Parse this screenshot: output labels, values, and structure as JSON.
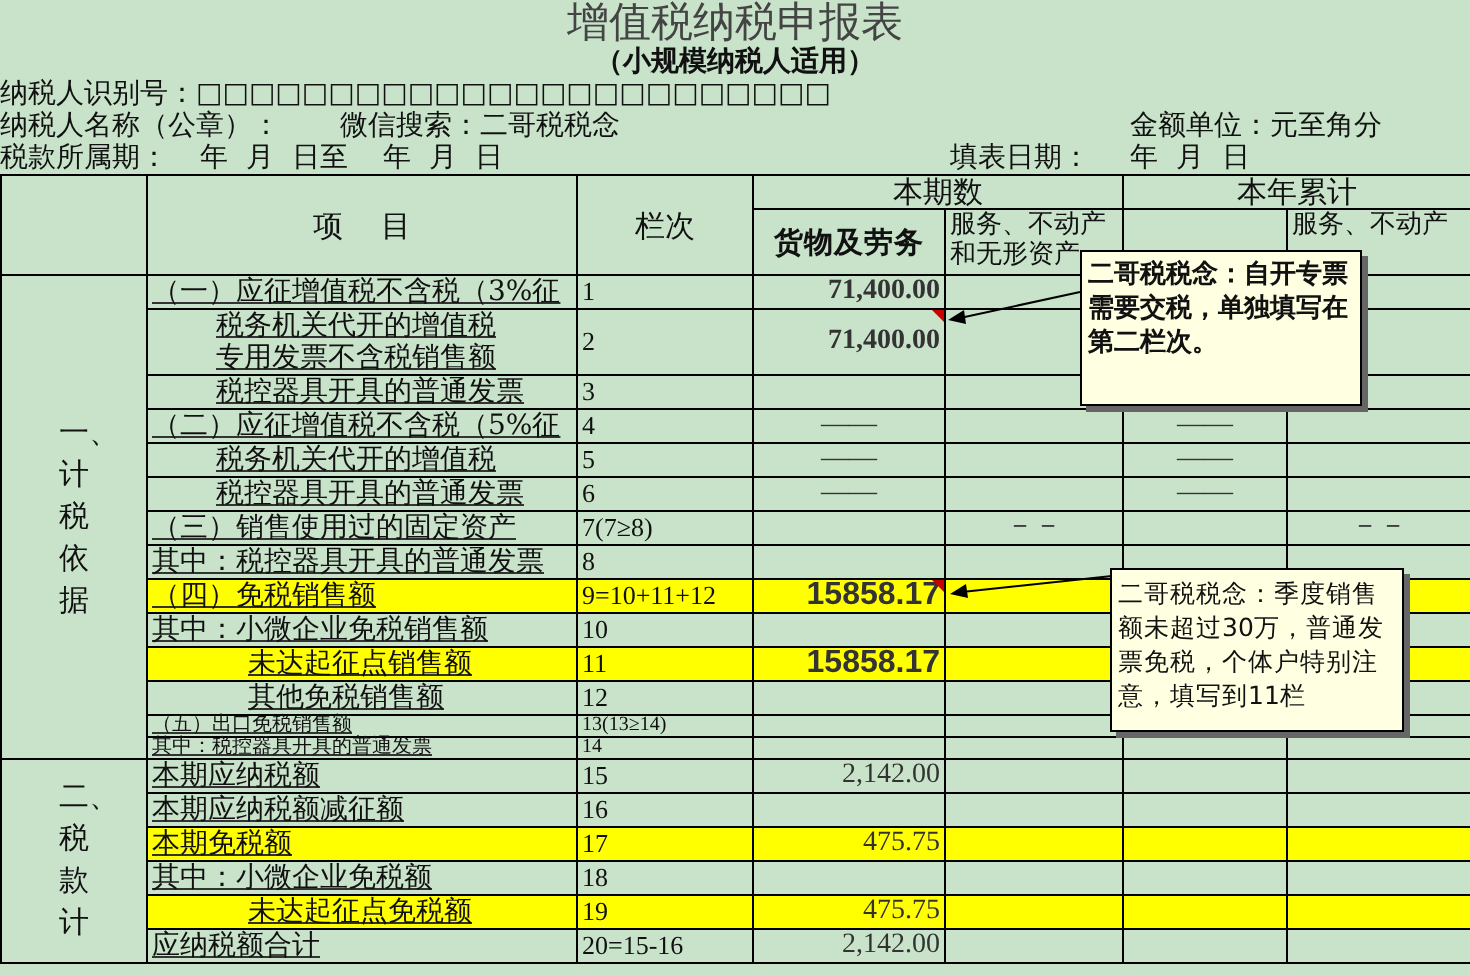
{
  "title": "增值税纳税申报表",
  "subtitle": "（小规模纳税人适用）",
  "taxpayer_id": {
    "label": "纳税人识别号：",
    "value": "□□□□□□□□□□□□□□□□□□□□□□□□"
  },
  "taxpayer_name": {
    "label": "纳税人名称（公章）：",
    "value": "微信搜索：二哥税税念"
  },
  "amount_unit": "金额单位：元至角分",
  "tax_period": {
    "label": "税款所属期：",
    "value": "年  月  日至    年  月  日"
  },
  "fill_date": {
    "label": "填表日期：",
    "value": "年  月  日"
  },
  "columns": {
    "item": "项    目",
    "seq": "栏次",
    "current_period": "本期数",
    "year_to_date": "本年累计",
    "sub": {
      "current_goods": "货物及劳务",
      "current_services": "服务、不动产和无形资产",
      "ytd_services": "服务、不动产"
    }
  },
  "sections": [
    {
      "label": "一、计税依据",
      "rows": [
        {
          "item": "（一）应征增值税不含税（3%征",
          "kind": "main",
          "seq": "1",
          "highlighted": false,
          "has_comment": false,
          "cells": {
            "current_goods": {
              "text": "71,400.00",
              "kind": "bold"
            }
          }
        },
        {
          "item": "税务机关代开的增值税专用发票不含税销售额",
          "kind": "sub",
          "seq": "2",
          "highlighted": false,
          "has_comment": true,
          "cells": {
            "current_goods": {
              "text": "71,400.00",
              "kind": "bold"
            }
          }
        },
        {
          "item": "税控器具开具的普通发票",
          "kind": "sub",
          "seq": "3",
          "highlighted": false,
          "has_comment": false,
          "cells": {}
        },
        {
          "item": "（二）应征增值税不含税（5%征",
          "kind": "main",
          "seq": "4",
          "highlighted": false,
          "has_comment": false,
          "cells": {
            "current_goods": {
              "text": "——",
              "kind": "center"
            },
            "ytd_goods": {
              "text": "——",
              "kind": "center"
            }
          }
        },
        {
          "item": "税务机关代开的增值税",
          "kind": "sub",
          "seq": "5",
          "highlighted": false,
          "has_comment": false,
          "cells": {
            "current_goods": {
              "text": "——",
              "kind": "center"
            },
            "ytd_goods": {
              "text": "——",
              "kind": "center"
            }
          }
        },
        {
          "item": "税控器具开具的普通发票",
          "kind": "sub",
          "seq": "6",
          "highlighted": false,
          "has_comment": false,
          "cells": {
            "current_goods": {
              "text": "——",
              "kind": "center"
            },
            "ytd_goods": {
              "text": "——",
              "kind": "center"
            }
          }
        },
        {
          "item": "（三）销售使用过的固定资产",
          "kind": "main",
          "seq": "7(7≥8)",
          "highlighted": false,
          "has_comment": false,
          "cells": {
            "current_services": {
              "text": "－－",
              "kind": "center"
            },
            "ytd_services": {
              "text": "－－",
              "kind": "center"
            }
          }
        },
        {
          "item": "其中：税控器具开具的普通发票",
          "kind": "main",
          "seq": "8",
          "highlighted": false,
          "has_comment": false,
          "cells": {}
        },
        {
          "item": "（四）免税销售额",
          "kind": "main",
          "seq": "9=10+11+12",
          "highlighted": true,
          "has_comment": true,
          "cells": {
            "current_goods": {
              "text": "15858.17",
              "kind": "large"
            }
          }
        },
        {
          "item": "其中：小微企业免税销售额",
          "kind": "main",
          "seq": "10",
          "highlighted": false,
          "has_comment": false,
          "cells": {}
        },
        {
          "item": "未达起征点销售额",
          "kind": "deep",
          "seq": "11",
          "highlighted": true,
          "has_comment": false,
          "cells": {
            "current_goods": {
              "text": "15858.17",
              "kind": "large"
            }
          }
        },
        {
          "item": "其他免税销售额",
          "kind": "deep",
          "seq": "12",
          "highlighted": false,
          "has_comment": false,
          "cells": {}
        },
        {
          "item": "（五）出口免税销售额",
          "kind": "squashed",
          "seq": "13(13≥14)",
          "highlighted": false,
          "has_comment": false,
          "cells": {}
        },
        {
          "item": "其中：税控器具开具的普通发票",
          "kind": "squashed",
          "seq": "14",
          "highlighted": false,
          "has_comment": false,
          "cells": {}
        }
      ]
    },
    {
      "label": "二、税款计",
      "rows": [
        {
          "item": "本期应纳税额",
          "kind": "main",
          "seq": "15",
          "highlighted": false,
          "has_comment": false,
          "cells": {
            "current_goods": {
              "text": "2,142.00",
              "kind": "plain"
            }
          }
        },
        {
          "item": "本期应纳税额减征额",
          "kind": "main",
          "seq": "16",
          "highlighted": false,
          "has_comment": false,
          "cells": {}
        },
        {
          "item": "本期免税额",
          "kind": "main",
          "seq": "17",
          "highlighted": true,
          "has_comment": false,
          "cells": {
            "current_goods": {
              "text": "475.75",
              "kind": "plain"
            }
          }
        },
        {
          "item": "其中：小微企业免税额",
          "kind": "main",
          "seq": "18",
          "highlighted": false,
          "has_comment": false,
          "cells": {}
        },
        {
          "item": "未达起征点免税额",
          "kind": "deep",
          "seq": "19",
          "highlighted": true,
          "has_comment": false,
          "cells": {
            "current_goods": {
              "text": "475.75",
              "kind": "plain"
            }
          }
        },
        {
          "item": "应纳税额合计",
          "kind": "main",
          "seq": "20=15-16",
          "highlighted": false,
          "has_comment": false,
          "cells": {
            "current_goods": {
              "text": "2,142.00",
              "kind": "plain"
            }
          }
        }
      ]
    }
  ],
  "comments": [
    {
      "text": "二哥税税念：自开专票需要交税，单独填写在第二栏次。",
      "bold": true
    },
    {
      "text": "二哥税税念：季度销售额未超过30万，普通发票免税，个体户特别注意，填写到11栏",
      "bold": false
    }
  ]
}
